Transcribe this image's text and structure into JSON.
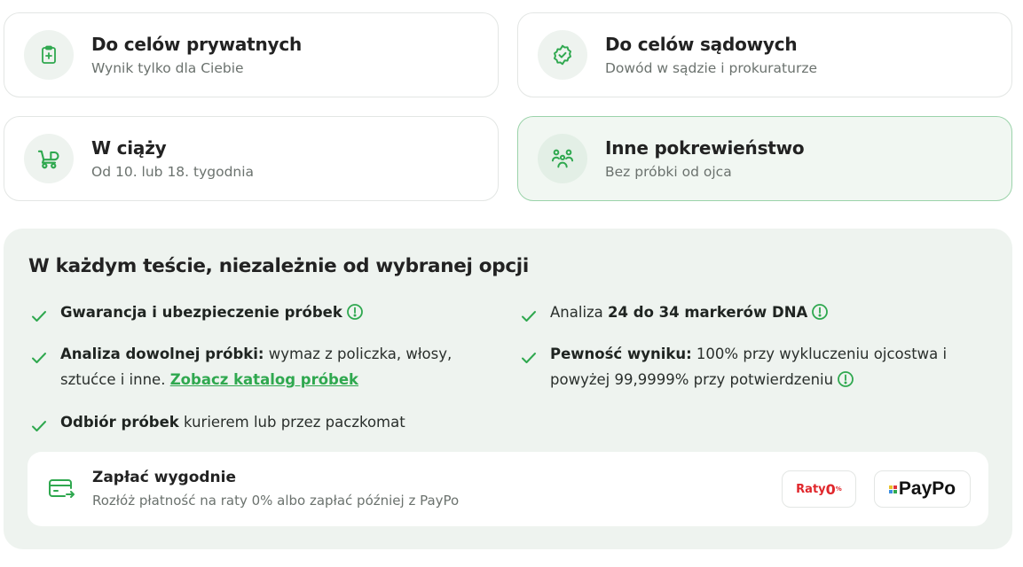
{
  "options": [
    {
      "title": "Do celów prywatnych",
      "subtitle": "Wynik tylko dla Ciebie",
      "icon": "clipboard-plus-icon"
    },
    {
      "title": "Do celów sądowych",
      "subtitle": "Dowód w sądzie i prokuraturze",
      "icon": "badge-check-icon"
    },
    {
      "title": "W ciąży",
      "subtitle": "Od 10. lub 18. tygodnia",
      "icon": "baby-stroller-icon"
    },
    {
      "title": "Inne pokrewieństwo",
      "subtitle": "Bez próbki od ojca",
      "icon": "family-icon",
      "selected": true
    }
  ],
  "features": {
    "title": "W każdym teście, niezależnie od wybranej opcji",
    "f1": {
      "bold": "Gwarancja i ubezpieczenie próbek"
    },
    "f2": {
      "pre": "Analiza ",
      "bold": "24 do 34 markerów DNA"
    },
    "f3": {
      "bold": "Analiza dowolnej próbki:",
      "text": " wymaz z policzka, włosy,",
      "line2": "sztućce i inne. ",
      "link": "Zobacz katalog próbek"
    },
    "f4": {
      "bold": "Pewność wyniku:",
      "text": " 100% przy wykluczeniu ojcostwa i",
      "line2": "powyżej 99,9999% przy potwierdzeniu"
    },
    "f5": {
      "bold": "Odbiór próbek",
      "text": " kurierem lub przez paczkomat"
    }
  },
  "payment": {
    "title": "Zapłać wygodnie",
    "subtitle": "Rozłóż płatność na raty 0% albo zapłać później z PayPo",
    "raty_label": "Raty",
    "raty_zero": "0",
    "raty_pct": "%",
    "paypo_label": "PayPo"
  },
  "colors": {
    "accent": "#2fa84f",
    "panel_bg": "#eef3ef",
    "selected_border": "#9bd3aa"
  }
}
